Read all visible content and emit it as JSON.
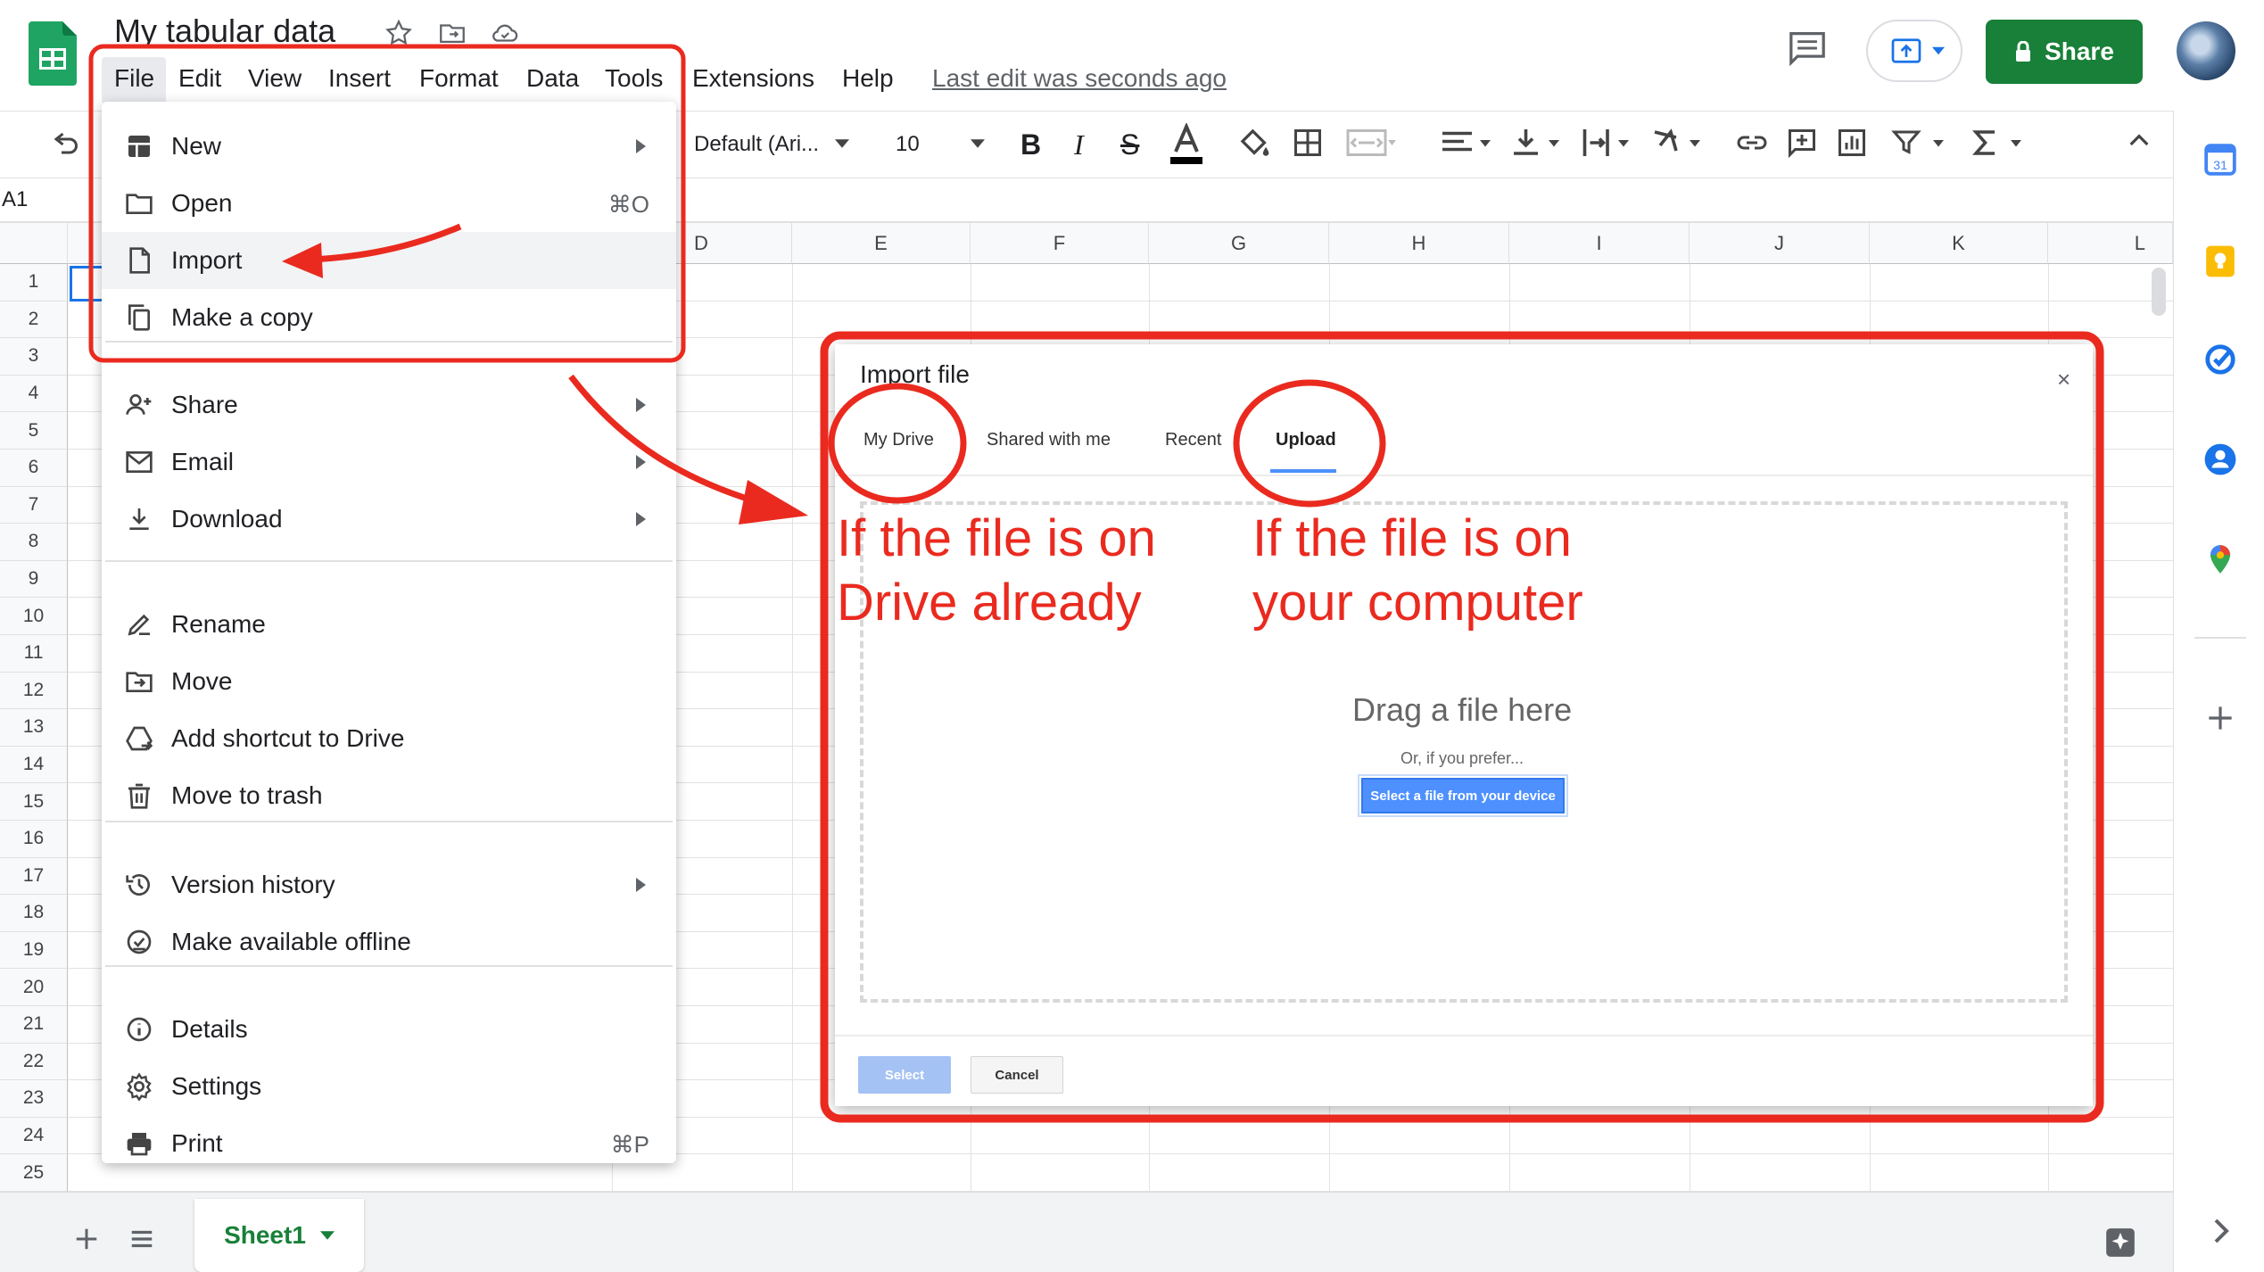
{
  "header": {
    "doc_title": "My tabular data",
    "menu": [
      "File",
      "Edit",
      "View",
      "Insert",
      "Format",
      "Data",
      "Tools",
      "Extensions",
      "Help"
    ],
    "last_edit": "Last edit was seconds ago",
    "share_label": "Share"
  },
  "toolbar": {
    "font": "Default (Ari...",
    "font_size": "10"
  },
  "name_box": "A1",
  "grid": {
    "columns": [
      "D",
      "E",
      "F",
      "G",
      "H",
      "I",
      "J",
      "K",
      "L"
    ],
    "rows": [
      "1",
      "2",
      "3",
      "4",
      "5",
      "6",
      "7",
      "8",
      "9",
      "10",
      "11",
      "12",
      "13",
      "14",
      "15",
      "16",
      "17",
      "18",
      "19",
      "20",
      "21",
      "22",
      "23",
      "24",
      "25"
    ]
  },
  "file_menu": {
    "items": [
      {
        "label": "New",
        "icon": "new-sheet-icon",
        "submenu": true
      },
      {
        "label": "Open",
        "icon": "folder-icon",
        "shortcut": "⌘O"
      },
      {
        "label": "Import",
        "icon": "file-icon"
      },
      {
        "label": "Make a copy",
        "icon": "copy-icon"
      },
      {
        "label": "Share",
        "icon": "person-add-icon",
        "submenu": true
      },
      {
        "label": "Email",
        "icon": "email-icon",
        "submenu": true
      },
      {
        "label": "Download",
        "icon": "download-icon",
        "submenu": true
      },
      {
        "label": "Rename",
        "icon": "rename-icon"
      },
      {
        "label": "Move",
        "icon": "move-icon"
      },
      {
        "label": "Add shortcut to Drive",
        "icon": "drive-shortcut-icon"
      },
      {
        "label": "Move to trash",
        "icon": "trash-icon"
      },
      {
        "label": "Version history",
        "icon": "history-icon",
        "submenu": true
      },
      {
        "label": "Make available offline",
        "icon": "offline-icon"
      },
      {
        "label": "Details",
        "icon": "info-icon"
      },
      {
        "label": "Settings",
        "icon": "settings-icon"
      },
      {
        "label": "Print",
        "icon": "print-icon",
        "shortcut": "⌘P"
      }
    ]
  },
  "dialog": {
    "title": "Import file",
    "close": "×",
    "tabs": [
      "My Drive",
      "Shared with me",
      "Recent",
      "Upload"
    ],
    "active_tab": "Upload",
    "drag_text": "Drag a file here",
    "or_text": "Or, if you prefer...",
    "select_device": "Select a file from your device",
    "select": "Select",
    "cancel": "Cancel"
  },
  "annotations": {
    "drive_note": [
      "If the file is on",
      "Drive already"
    ],
    "computer_note": [
      "If the file is on",
      "your computer"
    ]
  },
  "sheet_tab": "Sheet1",
  "colors": {
    "annotation": "#ea2a1f",
    "share": "#188038",
    "accent": "#4d90fe"
  }
}
